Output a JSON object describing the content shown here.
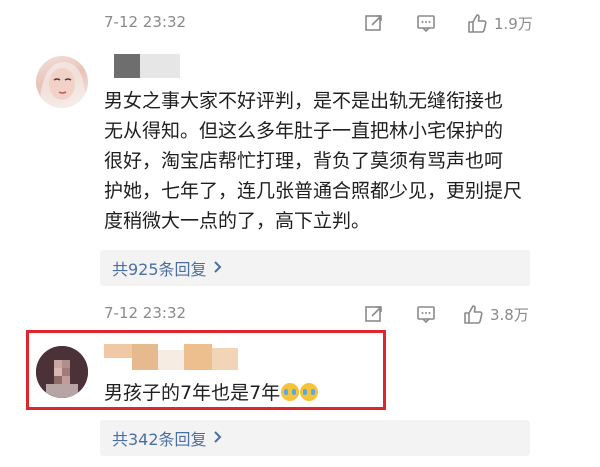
{
  "comments": [
    {
      "time": "7-12 23:32",
      "likes": "1.9万"
    },
    {
      "text_lines": [
        "男女之事大家不好评判，是不是出轨无缝衔接也",
        "无从得知。但这么多年肚子一直把林小宅保护的",
        "很好，淘宝店帮忙打理，背负了莫须有骂声也呵",
        "护她，七年了，连几张普通合照都少见，更别提尺",
        "度稍微大一点的了，高下立判。"
      ],
      "replies": "共925条回复",
      "time": "7-12 23:32",
      "likes": "3.8万"
    },
    {
      "text": "男孩子的7年也是7年",
      "replies": "共342条回复"
    }
  ],
  "icons": [
    "share-icon",
    "comment-icon",
    "like-icon",
    "chevron-right-icon",
    "crying-emoji-icon"
  ],
  "colors": {
    "link": "#4a6fa5",
    "highlight": "#e0262b",
    "meta": "#8a8a8a"
  }
}
